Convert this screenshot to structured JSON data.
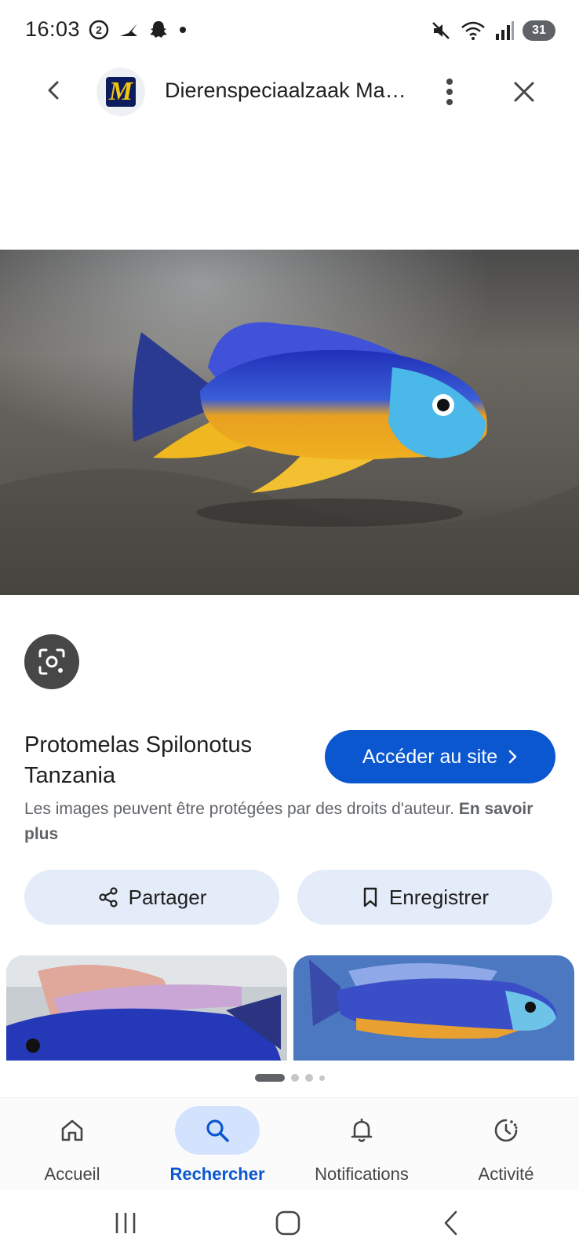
{
  "status_bar": {
    "time": "16:03",
    "left_icons": [
      "whatsapp-count-icon",
      "bird-icon",
      "snapchat-icon",
      "dot-icon"
    ],
    "right_icons": [
      "mute-icon",
      "wifi-icon",
      "signal-icon"
    ],
    "battery": "31"
  },
  "header": {
    "site_name": "Dierenspeciaalzaak Ma…",
    "logo_letter": "M"
  },
  "image": {
    "title": "Protomelas Spilonotus Tanzania",
    "visit_label": "Accéder au site",
    "copyright_text": "Les images peuvent être protégées par des droits d'auteur.",
    "learn_more": "En savoir plus"
  },
  "actions": {
    "share_label": "Partager",
    "save_label": "Enregistrer"
  },
  "bottom_nav": {
    "items": [
      {
        "label": "Accueil",
        "icon": "home-icon"
      },
      {
        "label": "Rechercher",
        "icon": "search-icon"
      },
      {
        "label": "Notifications",
        "icon": "bell-icon"
      },
      {
        "label": "Activité",
        "icon": "activity-icon"
      }
    ],
    "active": "Rechercher"
  },
  "colors": {
    "accent": "#0b57d0",
    "chip_bg": "#e4ecf9",
    "active_nav_bg": "#d3e3fd"
  }
}
